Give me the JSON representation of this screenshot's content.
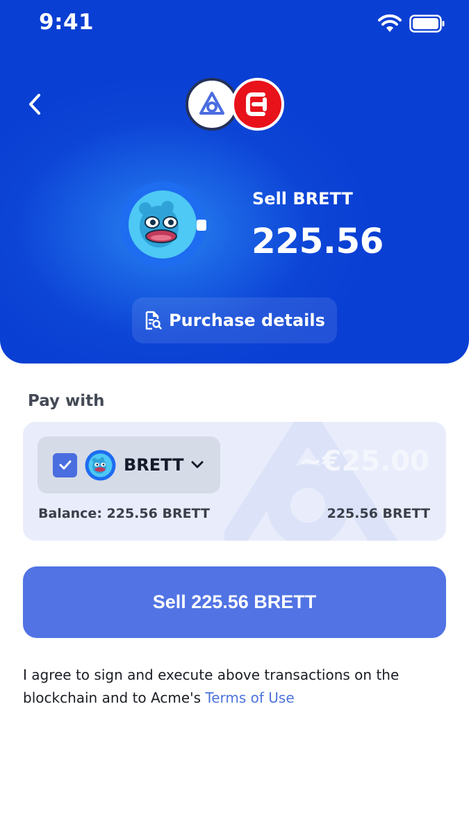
{
  "status_bar": {
    "time": "9:41"
  },
  "header": {
    "sell_label": "Sell BRETT",
    "sell_amount": "225.56",
    "details_button_label": "Purchase details"
  },
  "pay_with": {
    "title": "Pay with",
    "token_name": "BRETT",
    "checkbox_checked": true,
    "fiat_value": "~€25.00",
    "balance": "Balance: 225.56 BRETT",
    "amount": "225.56 BRETT"
  },
  "sell_button_label": "Sell 225.56 BRETT",
  "terms": {
    "text": "I agree to sign and execute above transactions on the blockchain and to Acme's ",
    "link": "Terms of Use"
  },
  "colors": {
    "header_blue": "#0a3fd3",
    "button_blue": "#5173e4",
    "chain_red": "#e8121b",
    "link_blue": "#4d74dd"
  },
  "icons": {
    "back": "chevron-left-icon",
    "wifi": "wifi-icon",
    "battery": "battery-icon",
    "dapp": "dapp-logo-icon",
    "chain": "chain-logo-icon",
    "token": "brett-token-icon",
    "details": "document-search-icon",
    "check": "check-icon",
    "dropdown": "chevron-down-icon"
  }
}
